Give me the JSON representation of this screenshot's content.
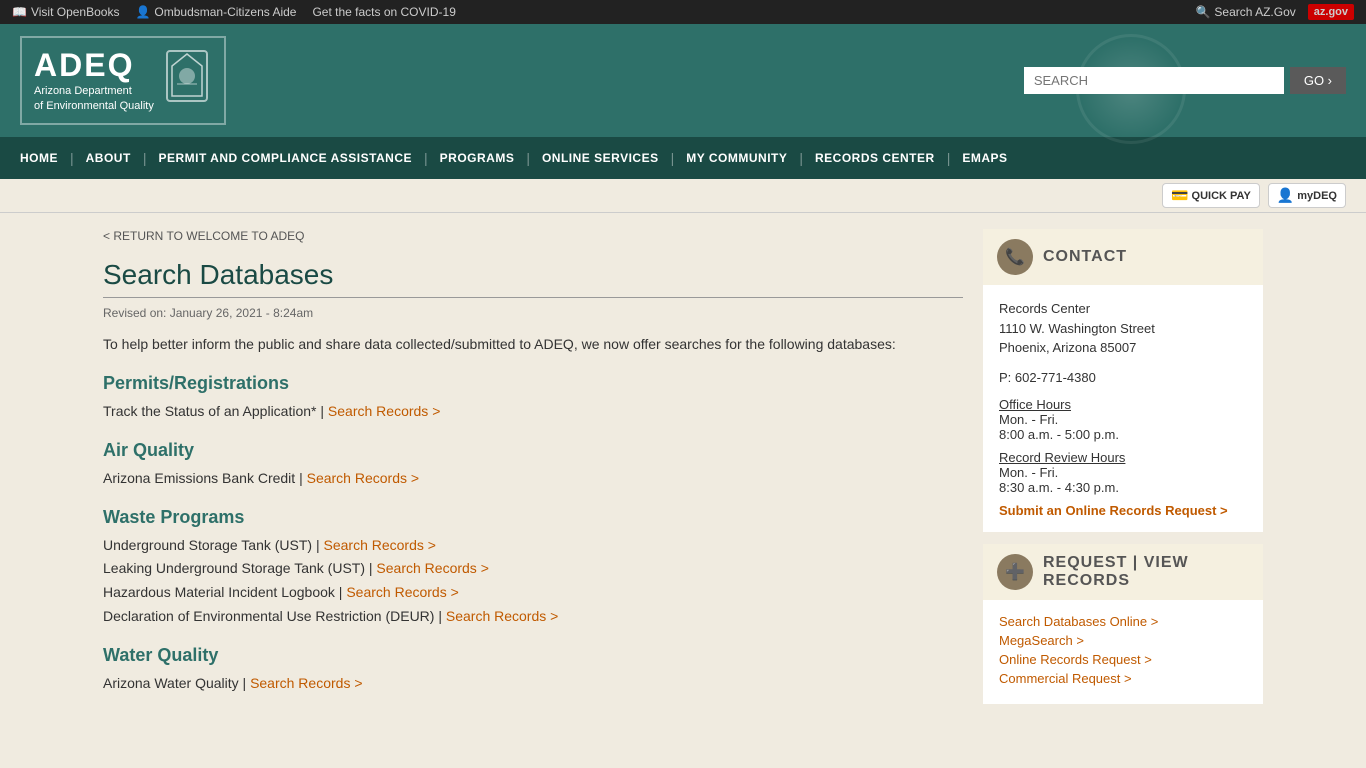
{
  "topbar": {
    "links": [
      {
        "label": "Visit OpenBooks",
        "icon": "📖"
      },
      {
        "label": "Ombudsman-Citizens Aide",
        "icon": "👤"
      },
      {
        "label": "Get the facts on COVID-19",
        "icon": ""
      }
    ],
    "right": [
      {
        "label": "Search AZ.Gov",
        "icon": "🔍"
      },
      {
        "label": "az.gov",
        "icon": ""
      }
    ]
  },
  "header": {
    "logo_adeq": "ADEQ",
    "logo_subtitle_line1": "Arizona Department",
    "logo_subtitle_line2": "of Environmental Quality",
    "search_placeholder": "SEARCH",
    "go_button": "GO ›"
  },
  "nav": {
    "items": [
      {
        "label": "HOME"
      },
      {
        "label": "ABOUT"
      },
      {
        "label": "PERMIT AND COMPLIANCE ASSISTANCE"
      },
      {
        "label": "PROGRAMS"
      },
      {
        "label": "ONLINE SERVICES"
      },
      {
        "label": "MY COMMUNITY"
      },
      {
        "label": "RECORDS CENTER"
      },
      {
        "label": "EMAPS"
      }
    ]
  },
  "subnav": {
    "quickpay": "QUICK PAY",
    "mydeq": "myDEQ"
  },
  "breadcrumb": "< RETURN TO WELCOME TO ADEQ",
  "main": {
    "title": "Search Databases",
    "revised": "Revised on: January 26, 2021 - 8:24am",
    "intro": "To help better inform the public and share data collected/submitted to ADEQ, we now offer searches for the following databases:",
    "sections": [
      {
        "title": "Permits/Registrations",
        "items": [
          {
            "text": "Track the Status of an Application* |",
            "link": "Search Records >"
          }
        ]
      },
      {
        "title": "Air Quality",
        "items": [
          {
            "text": "Arizona Emissions Bank Credit |",
            "link": "Search Records >"
          }
        ]
      },
      {
        "title": "Waste Programs",
        "items": [
          {
            "text": "Underground Storage Tank (UST) |",
            "link": "Search Records >"
          },
          {
            "text": "Leaking Underground Storage Tank (UST) |",
            "link": "Search Records >"
          },
          {
            "text": "Hazardous Material Incident Logbook |",
            "link": "Search Records >"
          },
          {
            "text": "Declaration of Environmental Use Restriction (DEUR) |",
            "link": "Search Records >"
          }
        ]
      },
      {
        "title": "Water Quality",
        "items": [
          {
            "text": "Arizona Water Quality |",
            "link": "Search Records >"
          }
        ]
      }
    ]
  },
  "sidebar": {
    "contact": {
      "header": "CONTACT",
      "name": "Records Center",
      "address_line1": "1110 W. Washington Street",
      "address_line2": "Phoenix, Arizona 85007",
      "phone": "P: 602-771-4380",
      "office_hours_label": "Office Hours",
      "office_hours_days": "Mon. - Fri.",
      "office_hours_time": "8:00 a.m. - 5:00 p.m.",
      "record_review_label": "Record Review Hours",
      "record_review_days": "Mon. - Fri.",
      "record_review_time": "8:30 a.m. - 4:30 p.m.",
      "online_request": "Submit an Online Records Request >"
    },
    "request": {
      "header": "REQUEST | VIEW RECORDS",
      "links": [
        "Search Databases Online >",
        "MegaSearch >",
        "Online Records Request >",
        "Commercial Request >"
      ]
    }
  }
}
